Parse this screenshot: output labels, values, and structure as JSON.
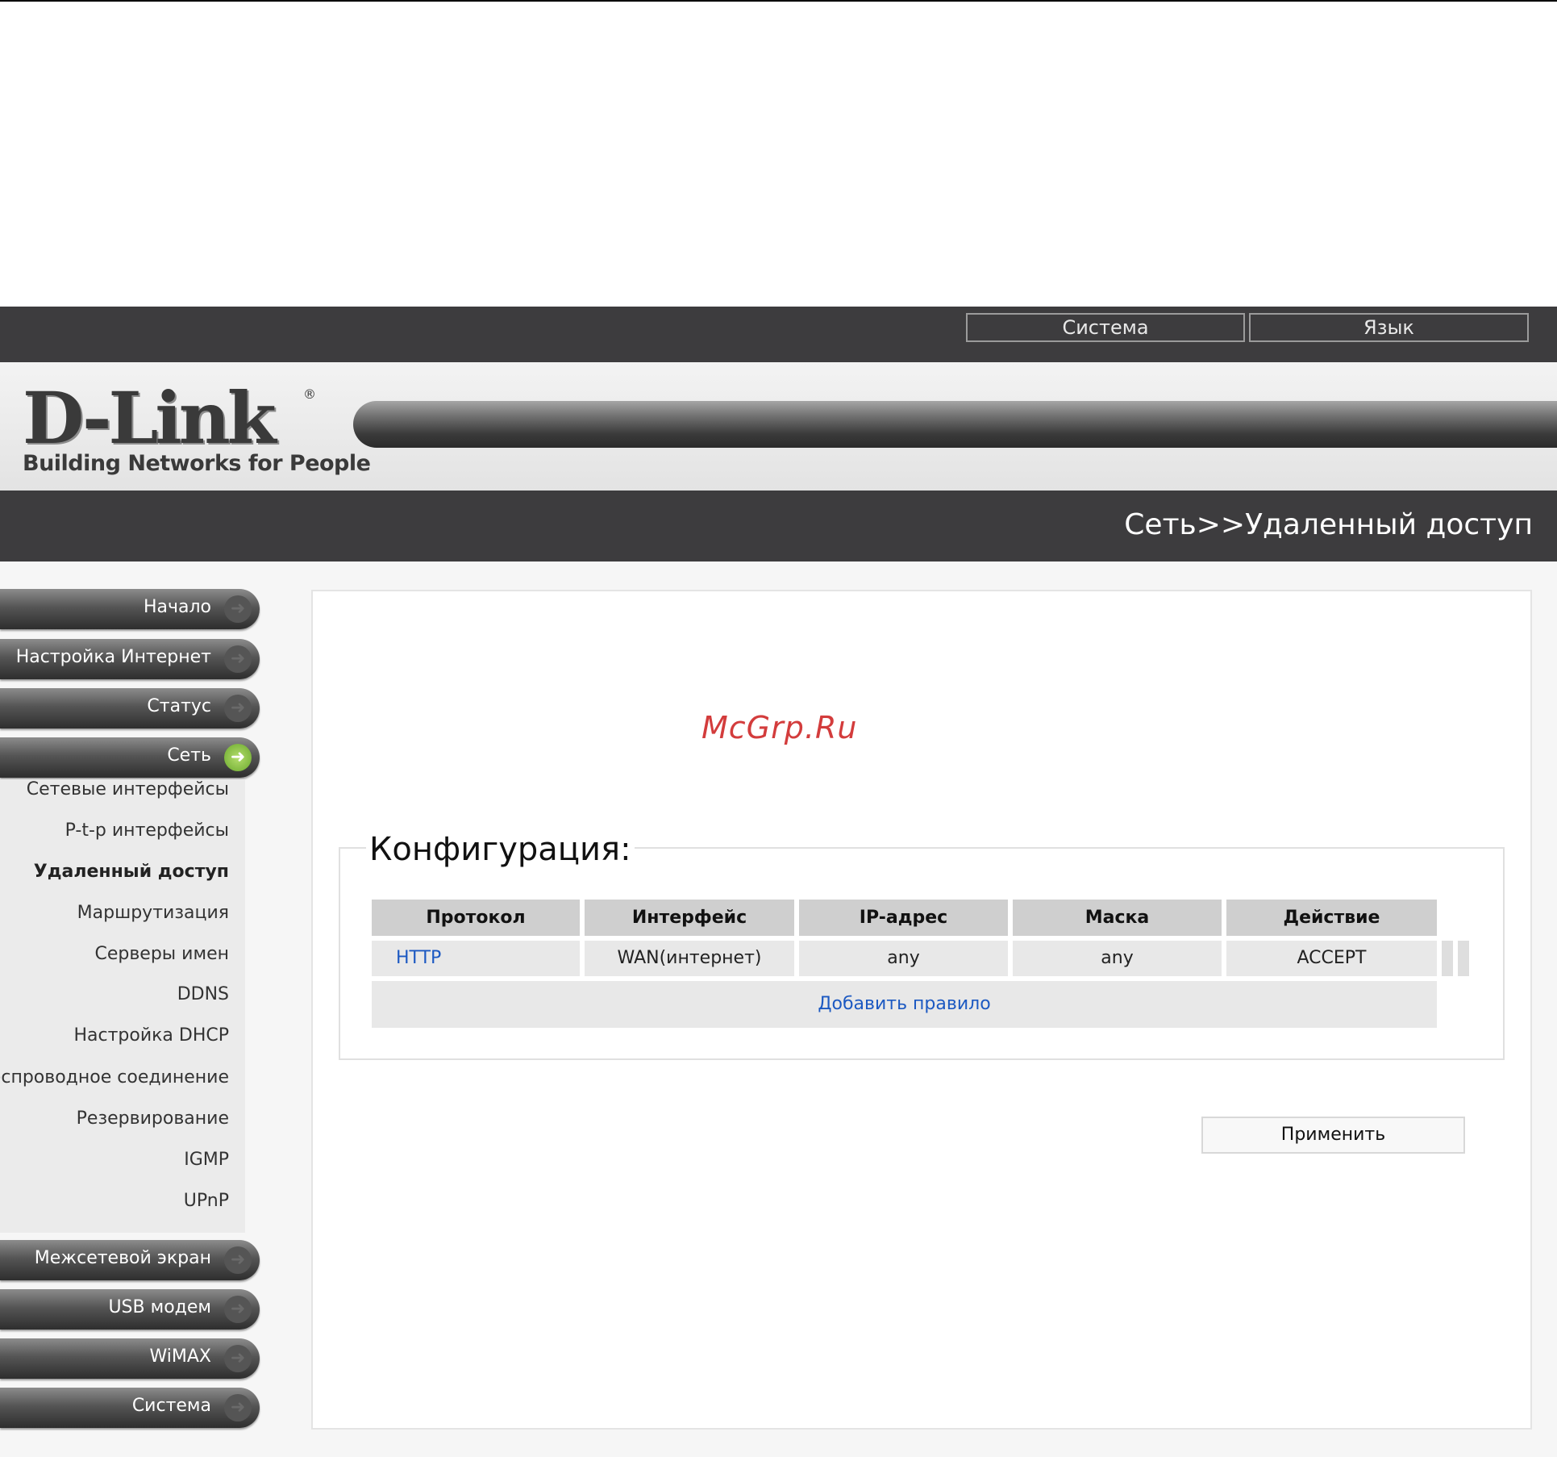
{
  "header": {
    "buttons": {
      "system": "Система",
      "language": "Язык"
    }
  },
  "logo": {
    "brand": "D-Link",
    "registered": "®",
    "tagline": "Building Networks for People"
  },
  "breadcrumb": "Сеть>>Удаленный доступ",
  "menu": {
    "top_items": [
      {
        "label": "Начало"
      },
      {
        "label": "Настройка Интернет"
      },
      {
        "label": "Статус"
      },
      {
        "label": "Сеть"
      }
    ],
    "network_subitems": [
      {
        "label": "Сетевые интерфейсы"
      },
      {
        "label": "P-t-p интерфейсы"
      },
      {
        "label": "Удаленный доступ"
      },
      {
        "label": "Маршрутизация"
      },
      {
        "label": "Серверы имен"
      },
      {
        "label": "DDNS"
      },
      {
        "label": "Настройка DHCP"
      },
      {
        "label": "Беспроводное соединение"
      },
      {
        "label": "Резервирование"
      },
      {
        "label": "IGMP"
      },
      {
        "label": "UPnP"
      }
    ],
    "bottom_items": [
      {
        "label": "Межсетевой экран"
      },
      {
        "label": "USB модем"
      },
      {
        "label": "WiMAX"
      },
      {
        "label": "Система"
      }
    ],
    "arrow_glyph": "➜",
    "active_accent": "#6aa92d"
  },
  "watermark": "McGrp.Ru",
  "config": {
    "legend": "Конфигурация:",
    "columns": [
      "Протокол",
      "Интерфейс",
      "IP-адрес",
      "Маска",
      "Действие"
    ],
    "rows": [
      {
        "protocol": "HTTP",
        "interface": "WAN(интернет)",
        "ip": "any",
        "mask": "any",
        "action": "ACCEPT"
      }
    ],
    "add_rule": "Добавить правило"
  },
  "apply_button": "Применить",
  "colors": {
    "dark_bar": "#3d3c3e",
    "link": "#1c59c2",
    "watermark": "#d33c3c"
  }
}
